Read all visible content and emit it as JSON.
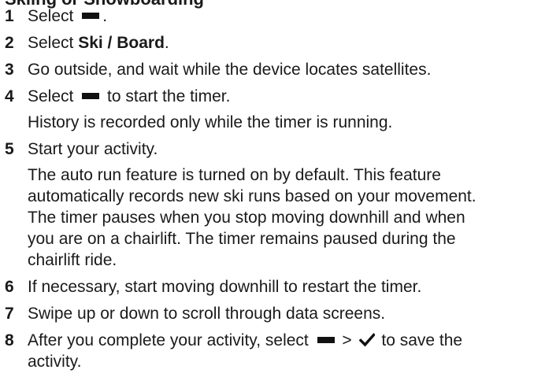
{
  "heading": "Skiing or Snowboarding",
  "steps": [
    {
      "num": "1",
      "text_before": "Select ",
      "icon": "action-bar-icon",
      "text_after": "."
    },
    {
      "num": "2",
      "text_before": "Select ",
      "bold": "Ski / Board",
      "text_after": "."
    },
    {
      "num": "3",
      "text": "Go outside, and wait while the device locates satellites."
    },
    {
      "num": "4",
      "text_before": "Select ",
      "icon": "action-bar-icon",
      "text_after": " to start the timer.",
      "note": "History is recorded only while the timer is running."
    },
    {
      "num": "5",
      "text": "Start your activity.",
      "note_lines": [
        "The auto run feature is turned on by default. This feature",
        "automatically records new ski runs based on your movement.",
        "The timer pauses when you stop moving downhill and when",
        "you are on a chairlift. The timer remains paused during the",
        "chairlift ride."
      ]
    },
    {
      "num": "6",
      "text": "If necessary, start moving downhill to restart the timer."
    },
    {
      "num": "7",
      "text": "Swipe up or down to scroll through data screens."
    },
    {
      "num": "8",
      "line1_before": "After you complete your activity, select ",
      "line1_mid": " > ",
      "line1_after": " to save the",
      "line2": "activity.",
      "icons": [
        "action-bar-icon",
        "checkmark-icon"
      ]
    }
  ]
}
